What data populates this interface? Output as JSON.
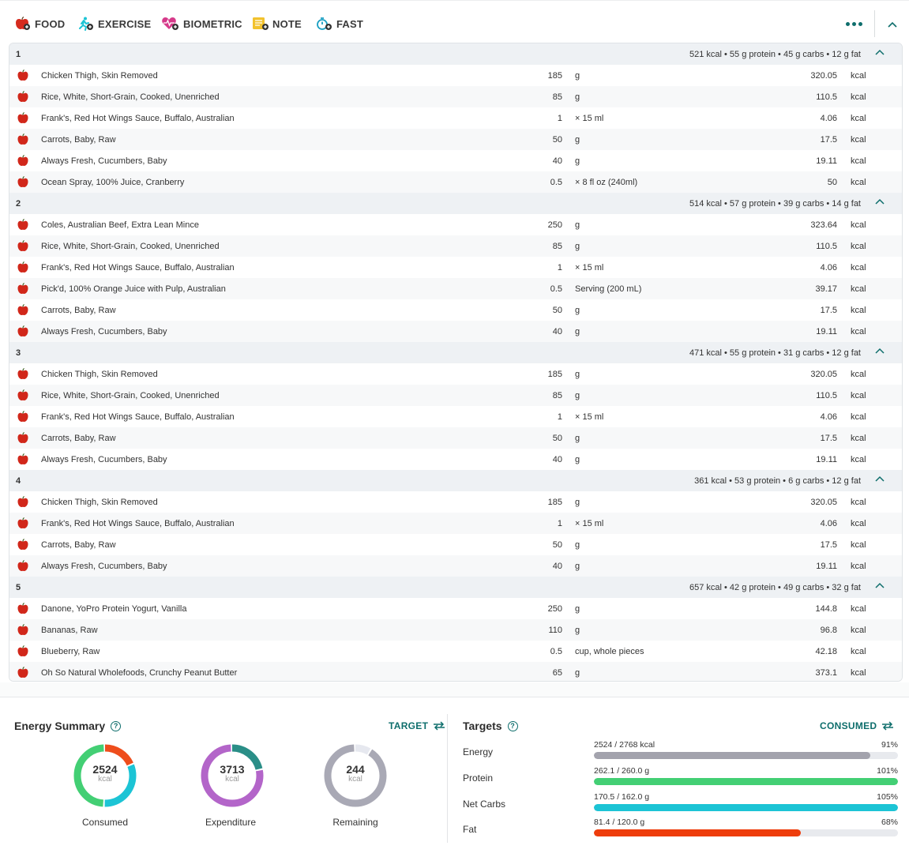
{
  "toolbar": {
    "food": "FOOD",
    "exercise": "EXERCISE",
    "biometric": "BIOMETRIC",
    "note": "NOTE",
    "fast": "FAST"
  },
  "meals": [
    {
      "number": "1",
      "summary": "521 kcal • 55 g protein • 45 g carbs • 12 g fat",
      "items": [
        {
          "name": "Chicken Thigh, Skin Removed",
          "amount": "185",
          "unit": "g",
          "energy": "320.05",
          "energy_unit": "kcal"
        },
        {
          "name": "Rice, White, Short-Grain, Cooked, Unenriched",
          "amount": "85",
          "unit": "g",
          "energy": "110.5",
          "energy_unit": "kcal"
        },
        {
          "name": "Frank's, Red Hot Wings Sauce, Buffalo, Australian",
          "amount": "1",
          "unit": "× 15 ml",
          "energy": "4.06",
          "energy_unit": "kcal"
        },
        {
          "name": "Carrots, Baby, Raw",
          "amount": "50",
          "unit": "g",
          "energy": "17.5",
          "energy_unit": "kcal"
        },
        {
          "name": "Always Fresh, Cucumbers, Baby",
          "amount": "40",
          "unit": "g",
          "energy": "19.11",
          "energy_unit": "kcal"
        },
        {
          "name": "Ocean Spray, 100% Juice, Cranberry",
          "amount": "0.5",
          "unit": "× 8 fl oz (240ml)",
          "energy": "50",
          "energy_unit": "kcal"
        }
      ]
    },
    {
      "number": "2",
      "summary": "514 kcal • 57 g protein • 39 g carbs • 14 g fat",
      "items": [
        {
          "name": "Coles, Australian Beef, Extra Lean Mince",
          "amount": "250",
          "unit": "g",
          "energy": "323.64",
          "energy_unit": "kcal"
        },
        {
          "name": "Rice, White, Short-Grain, Cooked, Unenriched",
          "amount": "85",
          "unit": "g",
          "energy": "110.5",
          "energy_unit": "kcal"
        },
        {
          "name": "Frank's, Red Hot Wings Sauce, Buffalo, Australian",
          "amount": "1",
          "unit": "× 15 ml",
          "energy": "4.06",
          "energy_unit": "kcal"
        },
        {
          "name": "Pick'd, 100% Orange Juice with Pulp, Australian",
          "amount": "0.5",
          "unit": "Serving (200 mL)",
          "energy": "39.17",
          "energy_unit": "kcal"
        },
        {
          "name": "Carrots, Baby, Raw",
          "amount": "50",
          "unit": "g",
          "energy": "17.5",
          "energy_unit": "kcal"
        },
        {
          "name": "Always Fresh, Cucumbers, Baby",
          "amount": "40",
          "unit": "g",
          "energy": "19.11",
          "energy_unit": "kcal"
        }
      ]
    },
    {
      "number": "3",
      "summary": "471 kcal • 55 g protein • 31 g carbs • 12 g fat",
      "items": [
        {
          "name": "Chicken Thigh, Skin Removed",
          "amount": "185",
          "unit": "g",
          "energy": "320.05",
          "energy_unit": "kcal"
        },
        {
          "name": "Rice, White, Short-Grain, Cooked, Unenriched",
          "amount": "85",
          "unit": "g",
          "energy": "110.5",
          "energy_unit": "kcal"
        },
        {
          "name": "Frank's, Red Hot Wings Sauce, Buffalo, Australian",
          "amount": "1",
          "unit": "× 15 ml",
          "energy": "4.06",
          "energy_unit": "kcal"
        },
        {
          "name": "Carrots, Baby, Raw",
          "amount": "50",
          "unit": "g",
          "energy": "17.5",
          "energy_unit": "kcal"
        },
        {
          "name": "Always Fresh, Cucumbers, Baby",
          "amount": "40",
          "unit": "g",
          "energy": "19.11",
          "energy_unit": "kcal"
        }
      ]
    },
    {
      "number": "4",
      "summary": "361 kcal • 53 g protein • 6 g carbs • 12 g fat",
      "items": [
        {
          "name": "Chicken Thigh, Skin Removed",
          "amount": "185",
          "unit": "g",
          "energy": "320.05",
          "energy_unit": "kcal"
        },
        {
          "name": "Frank's, Red Hot Wings Sauce, Buffalo, Australian",
          "amount": "1",
          "unit": "× 15 ml",
          "energy": "4.06",
          "energy_unit": "kcal"
        },
        {
          "name": "Carrots, Baby, Raw",
          "amount": "50",
          "unit": "g",
          "energy": "17.5",
          "energy_unit": "kcal"
        },
        {
          "name": "Always Fresh, Cucumbers, Baby",
          "amount": "40",
          "unit": "g",
          "energy": "19.11",
          "energy_unit": "kcal"
        }
      ]
    },
    {
      "number": "5",
      "summary": "657 kcal • 42 g protein • 49 g carbs • 32 g fat",
      "items": [
        {
          "name": "Danone, YoPro Protein Yogurt, Vanilla",
          "amount": "250",
          "unit": "g",
          "energy": "144.8",
          "energy_unit": "kcal"
        },
        {
          "name": "Bananas, Raw",
          "amount": "110",
          "unit": "g",
          "energy": "96.8",
          "energy_unit": "kcal"
        },
        {
          "name": "Blueberry, Raw",
          "amount": "0.5",
          "unit": "cup, whole pieces",
          "energy": "42.18",
          "energy_unit": "kcal"
        },
        {
          "name": "Oh So Natural Wholefoods, Crunchy Peanut Butter",
          "amount": "65",
          "unit": "g",
          "energy": "373.1",
          "energy_unit": "kcal"
        }
      ]
    }
  ],
  "energy_summary": {
    "title": "Energy Summary",
    "help": "?",
    "target_button": "TARGET",
    "rings": [
      {
        "label": "Consumed",
        "value": "2524",
        "unit": "kcal",
        "segments": [
          {
            "color": "#ee4d1c",
            "fraction": 0.19
          },
          {
            "color": "#1cc4d5",
            "fraction": 0.32
          },
          {
            "color": "#43cf74",
            "fraction": 0.49
          }
        ]
      },
      {
        "label": "Expenditure",
        "value": "3713",
        "unit": "kcal",
        "segments": [
          {
            "color": "#2a8e87",
            "fraction": 0.22
          },
          {
            "color": "#b365c9",
            "fraction": 0.78
          }
        ]
      },
      {
        "label": "Remaining",
        "value": "244",
        "unit": "kcal",
        "segments": [
          {
            "color": "#e6e8ef",
            "fraction": 0.09
          },
          {
            "color": "#a9a9b5",
            "fraction": 0.91
          }
        ]
      }
    ]
  },
  "targets": {
    "title": "Targets",
    "help": "?",
    "consumed_button": "CONSUMED",
    "rows": [
      {
        "label": "Energy",
        "text": "2524 / 2768 kcal",
        "pct": "91%",
        "fill": 0.91,
        "color": "#a3a3ad"
      },
      {
        "label": "Protein",
        "text": "262.1 / 260.0 g",
        "pct": "101%",
        "fill": 1.0,
        "color": "#43cf74"
      },
      {
        "label": "Net Carbs",
        "text": "170.5 / 162.0 g",
        "pct": "105%",
        "fill": 1.0,
        "color": "#1cc4d5"
      },
      {
        "label": "Fat",
        "text": "81.4 / 120.0 g",
        "pct": "68%",
        "fill": 0.68,
        "color": "#ee3d0c"
      }
    ]
  }
}
